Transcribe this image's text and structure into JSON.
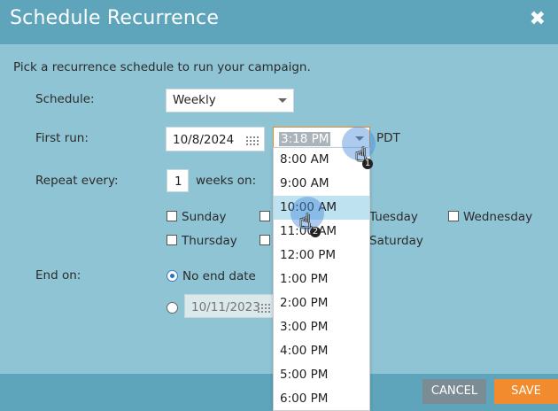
{
  "dialog": {
    "title": "Schedule Recurrence",
    "close_glyph": "✖",
    "intro": "Pick a recurrence schedule to run your campaign."
  },
  "schedule": {
    "label": "Schedule:",
    "value": "Weekly"
  },
  "first_run": {
    "label": "First run:",
    "date": "10/8/2024",
    "time": "3:18 PM",
    "timezone": "PDT"
  },
  "repeat": {
    "label": "Repeat every:",
    "value": "1",
    "suffix": "weeks on:",
    "days": [
      {
        "label": "Sunday",
        "checked": false
      },
      {
        "label": "Tuesday",
        "checked": false
      },
      {
        "label": "Wednesday",
        "checked": false
      },
      {
        "label": "Thursday",
        "checked": false
      },
      {
        "label": "Saturday",
        "checked": false
      }
    ]
  },
  "end_on": {
    "label": "End on:",
    "no_end_label": "No end date",
    "no_end_selected": true,
    "end_date": "10/11/2023"
  },
  "time_options": [
    "8:00 AM",
    "9:00 AM",
    "10:00 AM",
    "11:00 AM",
    "12:00 PM",
    "1:00 PM",
    "2:00 PM",
    "3:00 PM",
    "4:00 PM",
    "5:00 PM",
    "6:00 PM"
  ],
  "time_highlighted": "10:00 AM",
  "cursors": [
    {
      "step": "1",
      "icon": "hand-pointer-icon"
    },
    {
      "step": "2",
      "icon": "hand-pointer-icon"
    }
  ],
  "footer": {
    "cancel": "CANCEL",
    "save": "SAVE"
  },
  "colors": {
    "header": "#5ea5bb",
    "body": "#8fc4d4",
    "save": "#f18b2e",
    "cancel": "#7b8c95",
    "highlight": "#bfe2f1"
  }
}
